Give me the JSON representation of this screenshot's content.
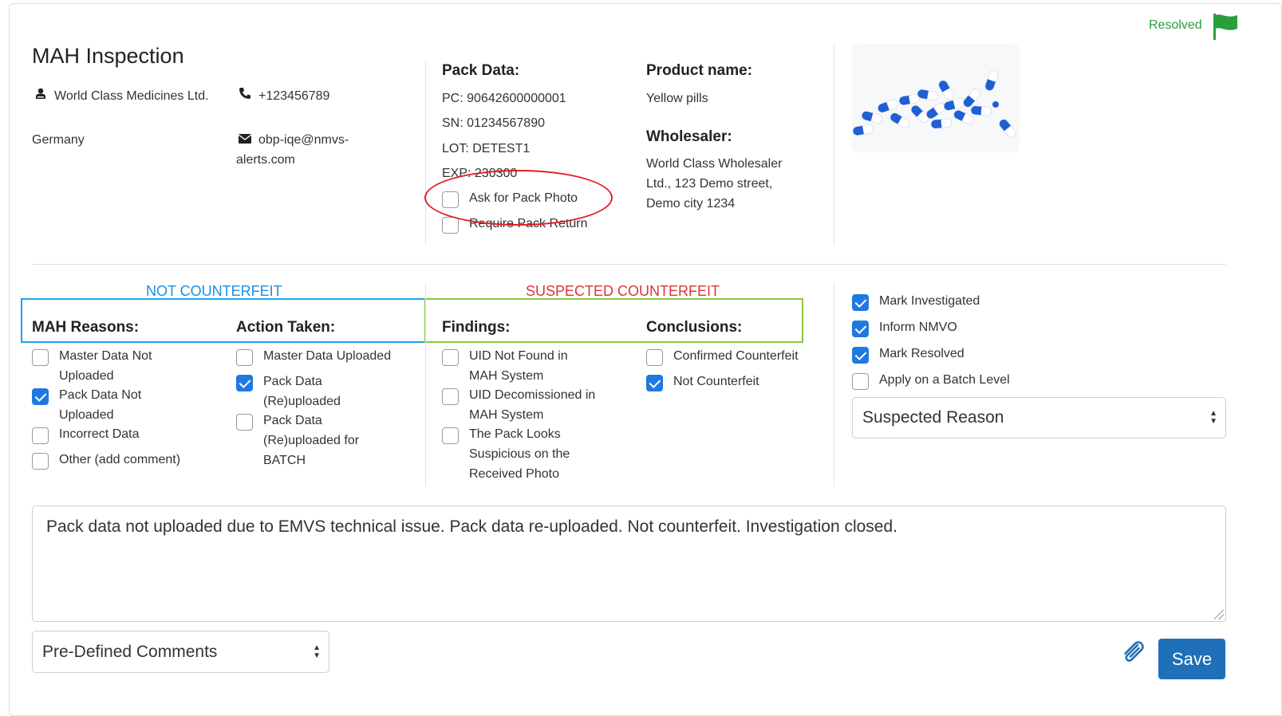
{
  "status": {
    "label": "Resolved",
    "color": "#2a9d3c",
    "icon": "flag-icon"
  },
  "title": "MAH Inspection",
  "company": {
    "name": "World Class Medicines Ltd.",
    "country": "Germany",
    "phone": "+123456789",
    "email": "obp-iqe@nmvs-alerts.com"
  },
  "pack": {
    "heading": "Pack Data:",
    "pc": "PC: 90642600000001",
    "sn": "SN: 01234567890",
    "lot": "LOT: DETEST1",
    "exp": "EXP: 230300",
    "ask_photo_label": "Ask for Pack Photo",
    "require_return_label": "Require Pack Return"
  },
  "product": {
    "heading": "Product name:",
    "name": "Yellow pills",
    "wholesaler_heading": "Wholesaler:",
    "wholesaler_line1": "World Class Wholesaler",
    "wholesaler_line2": "Ltd., 123 Demo street,",
    "wholesaler_line3": "Demo city 1234"
  },
  "groups": {
    "not_counterfeit": {
      "label": "NOT COUNTERFEIT",
      "color": "#1a8fe0"
    },
    "suspected_counterfeit": {
      "label": "SUSPECTED COUNTERFEIT",
      "color": "#e0323a"
    }
  },
  "mah_reasons": {
    "heading": "MAH Reasons:",
    "items": [
      {
        "l1": "Master Data Not",
        "l2": "Uploaded",
        "checked": false
      },
      {
        "l1": "Pack Data Not",
        "l2": "Uploaded",
        "checked": true
      },
      {
        "l1": "Incorrect Data",
        "l2": "",
        "checked": false
      },
      {
        "l1": "Other (add comment)",
        "l2": "",
        "checked": false
      }
    ]
  },
  "action_taken": {
    "heading": "Action Taken:",
    "items": [
      {
        "l1": "Master Data Uploaded",
        "checked": false
      },
      {
        "l1": "Pack Data",
        "l2": "(Re)uploaded",
        "checked": true
      },
      {
        "l1": "Pack Data",
        "l2": "(Re)uploaded for",
        "l3": "BATCH",
        "checked": false
      }
    ]
  },
  "findings": {
    "heading": "Findings:",
    "items": [
      {
        "l1": "UID Not Found in",
        "l2": "MAH System",
        "checked": false
      },
      {
        "l1": "UID Decomissioned in",
        "l2": "MAH System",
        "checked": false
      },
      {
        "l1": "The Pack Looks",
        "l2": "Suspicious on the",
        "l3": "Received Photo",
        "checked": false
      }
    ]
  },
  "conclusions": {
    "heading": "Conclusions:",
    "items": [
      {
        "l1": "Confirmed Counterfeit",
        "checked": false
      },
      {
        "l1": "Not Counterfeit",
        "checked": true
      }
    ]
  },
  "marks": {
    "items": [
      {
        "l1": "Mark Investigated",
        "checked": true
      },
      {
        "l1": "Inform NMVO",
        "checked": true
      },
      {
        "l1": "Mark Resolved",
        "checked": true
      },
      {
        "l1": "Apply on a Batch Level",
        "checked": false
      }
    ],
    "suspected_reason": "Suspected Reason"
  },
  "comment": "Pack data not uploaded due to EMVS technical issue. Pack data re-uploaded. Not counterfeit. Investigation closed.",
  "predefined_comments": "Pre-Defined Comments",
  "attach_icon": "paperclip-icon",
  "save_label": "Save",
  "colors": {
    "primary": "#1f6fb9",
    "checkbox": "#1f7ae0"
  }
}
